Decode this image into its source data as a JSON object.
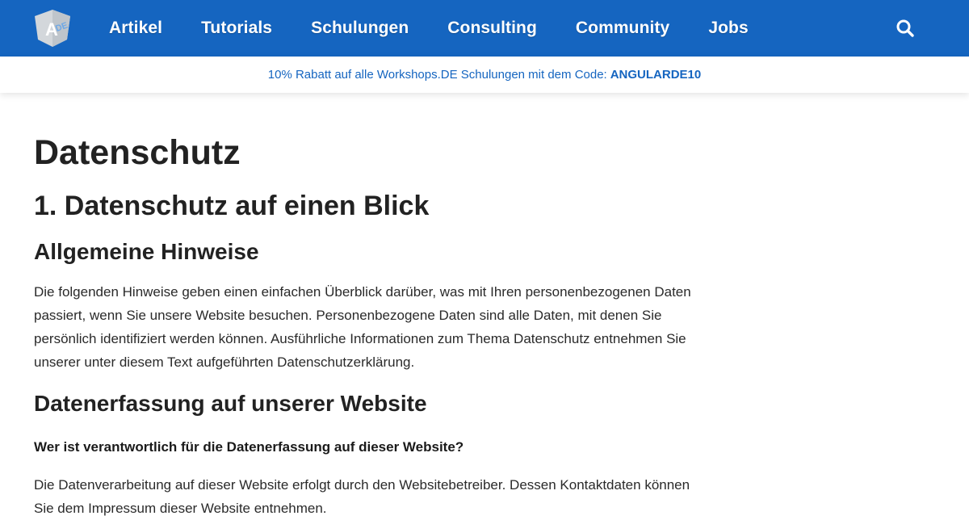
{
  "nav": {
    "logo_alt": "Angular.DE",
    "items": [
      {
        "label": "Artikel"
      },
      {
        "label": "Tutorials"
      },
      {
        "label": "Schulungen"
      },
      {
        "label": "Consulting"
      },
      {
        "label": "Community"
      },
      {
        "label": "Jobs"
      }
    ],
    "search_icon": "search-icon"
  },
  "promo": {
    "text": "10% Rabatt auf alle Workshops.DE Schulungen mit dem Code:",
    "code": "ANGULARDE10"
  },
  "page": {
    "title": "Datenschutz",
    "section1_heading": "1. Datenschutz auf einen Blick",
    "subheading1": "Allgemeine Hinweise",
    "paragraph1": "Die folgenden Hinweise geben einen einfachen Überblick darüber, was mit Ihren personenbezogenen Daten passiert, wenn Sie unsere Website besuchen. Personenbezogene Daten sind alle Daten, mit denen Sie persönlich identifiziert werden können. Ausführliche Informationen zum Thema Datenschutz entnehmen Sie unserer unter diesem Text aufgeführten Datenschutzerklärung.",
    "subheading2": "Datenerfassung auf unserer Website",
    "question1": "Wer ist verantwortlich für die Datenerfassung auf dieser Website?",
    "paragraph2": "Die Datenverarbeitung auf dieser Website erfolgt durch den Websitebetreiber. Dessen Kontaktdaten können Sie dem Impressum dieser Website entnehmen."
  },
  "colors": {
    "brand": "#1565c0",
    "logo_shield": "#c8cdd2",
    "logo_accent": "#6ea8e6"
  }
}
